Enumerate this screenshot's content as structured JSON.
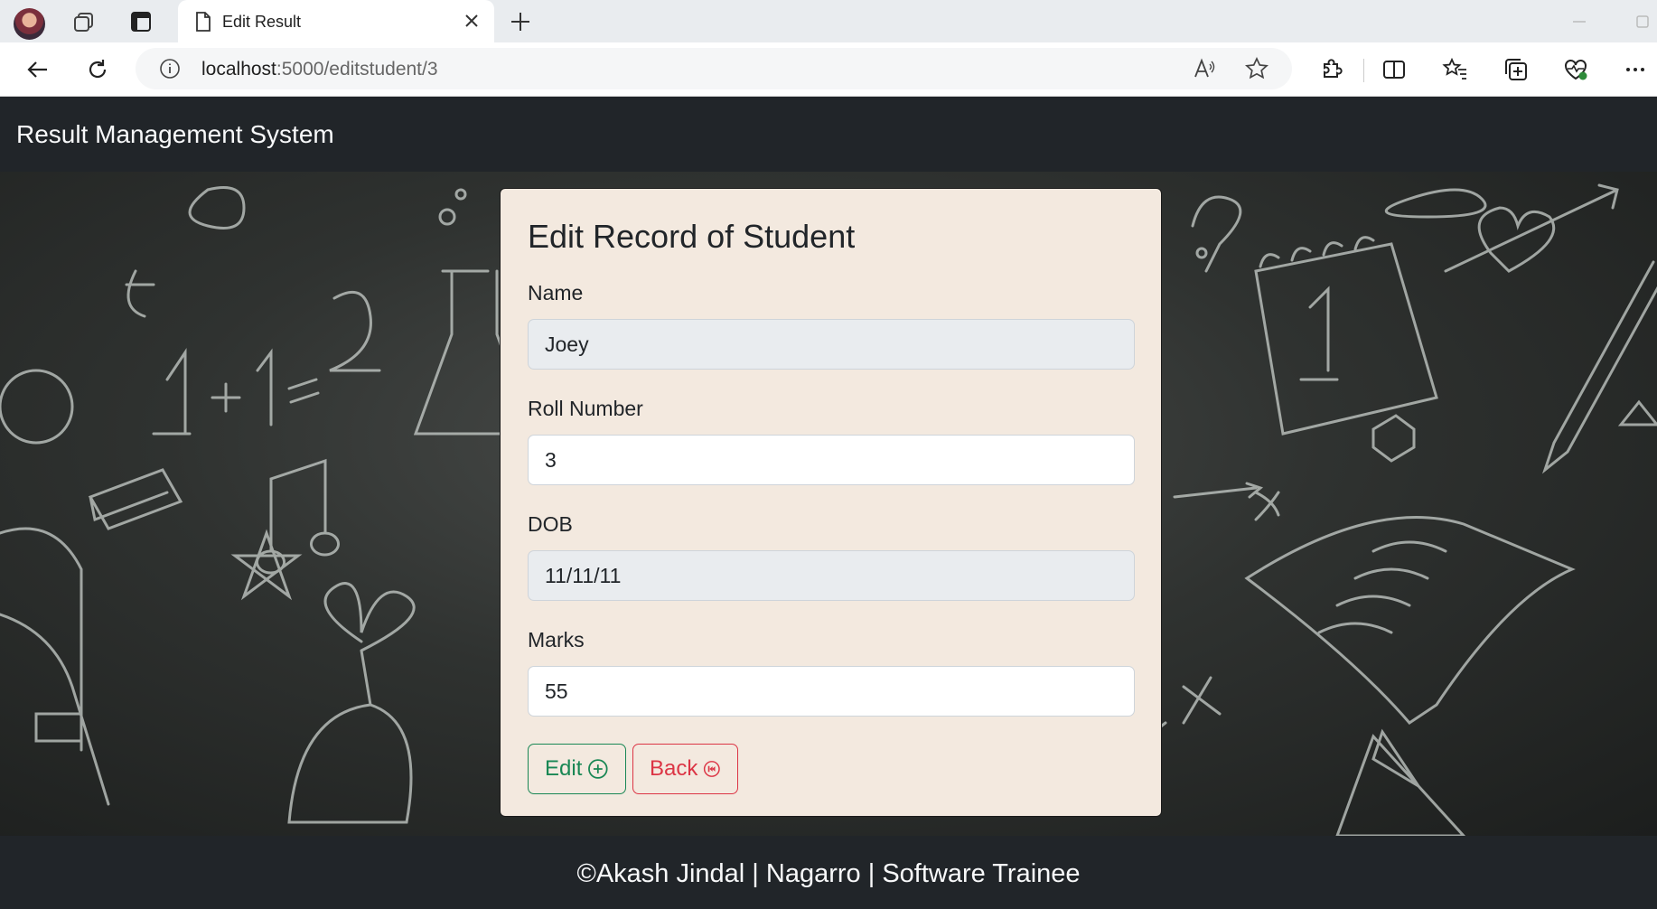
{
  "browser": {
    "tab": {
      "title": "Edit Result",
      "close_icon": "close-icon"
    },
    "address": {
      "host": "localhost",
      "path": ":5000/editstudent/3"
    }
  },
  "navbar": {
    "brand": "Result Management System"
  },
  "form": {
    "title": "Edit Record of Student",
    "fields": [
      {
        "label": "Name",
        "value": "Joey",
        "readonly": true
      },
      {
        "label": "Roll Number",
        "value": "3",
        "readonly": false
      },
      {
        "label": "DOB",
        "value": "11/11/11",
        "readonly": true
      },
      {
        "label": "Marks",
        "value": "55",
        "readonly": false
      }
    ],
    "buttons": {
      "edit": {
        "label": "Edit",
        "icon": "plus-circle-icon",
        "color": "#198754"
      },
      "back": {
        "label": "Back",
        "icon": "skip-back-circle-icon",
        "color": "#dc3545"
      }
    }
  },
  "footer": {
    "text": "©Akash Jindal | Nagarro | Software Trainee"
  },
  "colors": {
    "navbar": "#212529",
    "card": "#f3e9df",
    "readonly_field": "#e9ecef"
  }
}
